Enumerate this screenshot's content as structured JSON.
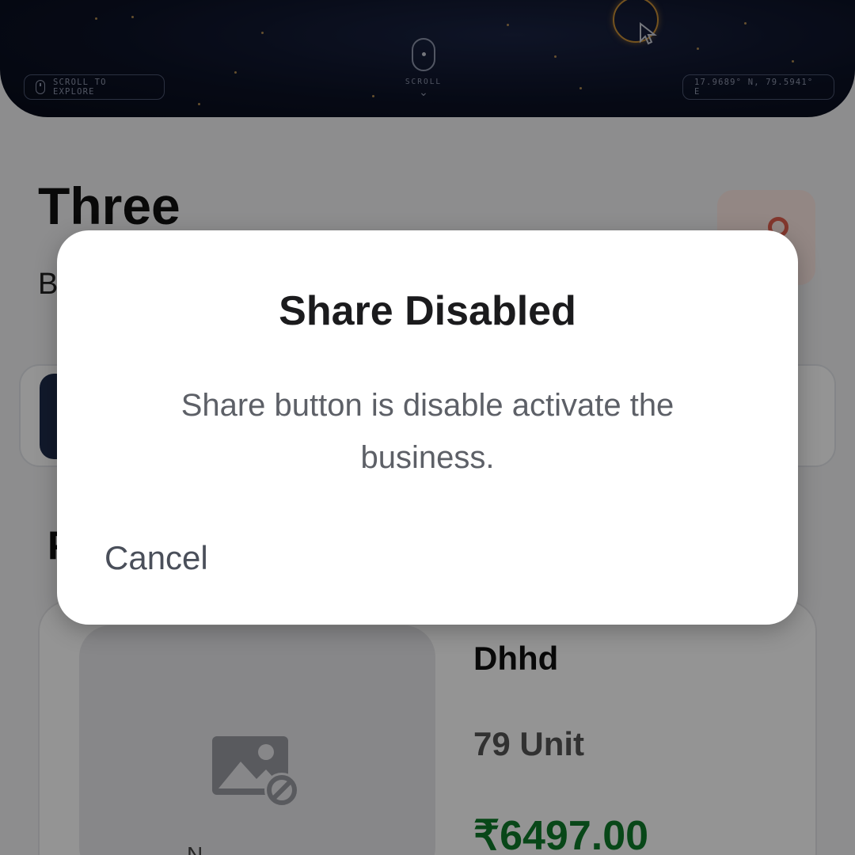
{
  "hero": {
    "scroll_explore_label": "SCROLL TO EXPLORE",
    "scroll_label": "SCROLL",
    "coordinates": "17.9689° N, 79.5941° E"
  },
  "business": {
    "name": "Three",
    "subtitle_partial": "B"
  },
  "section": {
    "title_partial": "P"
  },
  "product": {
    "name": "Dhhd",
    "quantity": "79 Unit",
    "price": "₹6497.00",
    "image_placeholder_label": "N"
  },
  "dialog": {
    "title": "Share Disabled",
    "message": "Share button is disable activate the business.",
    "cancel_label": "Cancel"
  },
  "colors": {
    "price_green": "#0f7a2a",
    "accent_orange": "#e2604e",
    "hero_bg": "#0c1226"
  },
  "icons": [
    "mouse-icon",
    "cursor-icon",
    "location-pin-icon",
    "image-unavailable-icon",
    "chevron-down-icon"
  ]
}
